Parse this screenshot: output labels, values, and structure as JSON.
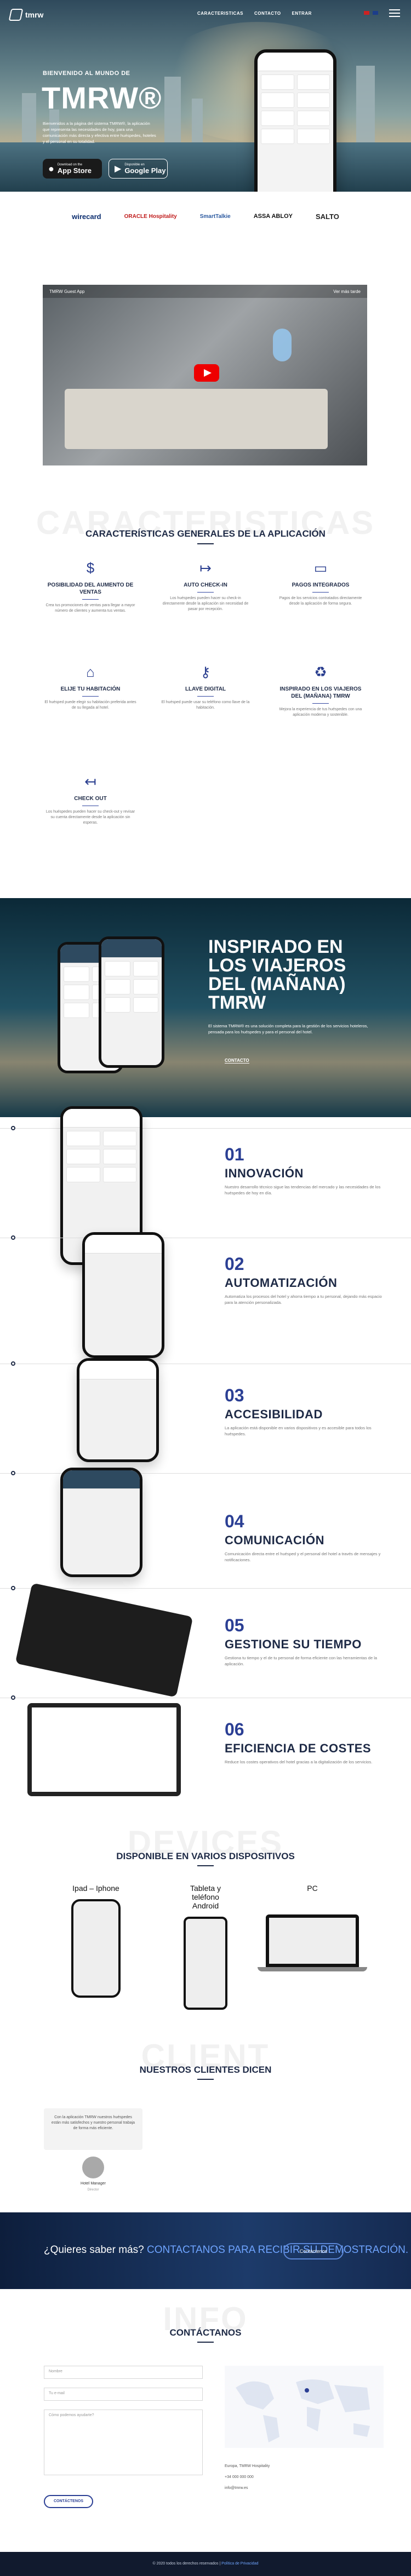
{
  "nav": {
    "brand": "tmrw",
    "links": [
      "CARACTERISTICAS",
      "CONTACTO",
      "ENTRAR"
    ]
  },
  "hero": {
    "subtitle": "BIENVENIDO AL MUNDO DE",
    "title": "TMRW®",
    "text": "Bienvenidos a la página del sistema TMRW®, la aplicación que representa las necesidades de hoy, para una comunicación más directa y efectiva entre huéspedes, hoteles y el personal en su totalidad.",
    "apple_small": "Download on the",
    "apple_big": "App Store",
    "google_small": "Disponible en",
    "google_big": "Google Play"
  },
  "partners": [
    "wirecard",
    "ORACLE Hospitality",
    "SmartTalkie",
    "ASSA ABLOY",
    "SALTO"
  ],
  "video": {
    "title": "TMRW Guest App",
    "action": "Ver más tarde"
  },
  "features": {
    "ghost": "CARACTERISTICAS",
    "title": "CARACTERÍSTICAS GENERALES DE LA APLICACIÓN",
    "items": [
      {
        "icon": "$",
        "title": "POSIBILIDAD DEL AUMENTO DE VENTAS",
        "text": "Crea tus promociones de ventas para llegar a mayor número de clientes y aumenta tus ventas."
      },
      {
        "icon": "↦",
        "title": "AUTO CHECK-IN",
        "text": "Los huéspedes pueden hacer su check-in directamente desde la aplicación sin necesidad de pasar por recepción."
      },
      {
        "icon": "▭",
        "title": "PAGOS INTEGRADOS",
        "text": "Pagos de los servicios contratados directamente desde la aplicación de forma segura."
      },
      {
        "icon": "⌂",
        "title": "ELIJE TU HABITACIÓN",
        "text": "El huésped puede elegir su habitación preferida antes de su llegada al hotel."
      },
      {
        "icon": "⚷",
        "title": "LLAVE DIGITAL",
        "text": "El huésped puede usar su teléfono como llave de la habitación."
      },
      {
        "icon": "♻",
        "title": "INSPIRADO EN LOS VIAJEROS DEL (MAÑANA) TMRW",
        "text": "Mejora la experiencia de tus huéspedes con una aplicación moderna y sostenible."
      },
      {
        "icon": "↤",
        "title": "CHECK OUT",
        "text": "Los huéspedes pueden hacer su check-out y revisar su cuenta directamente desde la aplicación sin esperas."
      }
    ]
  },
  "inspirado": {
    "title": "INSPIRADO EN LOS VIAJEROS DEL (MAÑANA) TMRW",
    "text": "El sistema TMRW® es una solución completa para la gestión de los servicios hoteleros, pensada para los huéspedes y para el personal del hotel.",
    "link": "CONTACTO"
  },
  "timeline": [
    {
      "num": "01",
      "title": "INNOVACIÓN",
      "text": "Nuestro desarrollo técnico sigue las tendencias del mercado y las necesidades de los huéspedes de hoy en día."
    },
    {
      "num": "02",
      "title": "AUTOMATIZACIÓN",
      "text": "Automatiza los procesos del hotel y ahorra tiempo a tu personal, dejando más espacio para la atención personalizada."
    },
    {
      "num": "03",
      "title": "ACCESIBILIDAD",
      "text": "La aplicación está disponible en varios dispositivos y es accesible para todos los huéspedes."
    },
    {
      "num": "04",
      "title": "COMUNICACIÓN",
      "text": "Comunicación directa entre el huésped y el personal del hotel a través de mensajes y notificaciones."
    },
    {
      "num": "05",
      "title": "GESTIONE SU TIEMPO",
      "text": "Gestiona tu tiempo y el de tu personal de forma eficiente con las herramientas de la aplicación."
    },
    {
      "num": "06",
      "title": "EFICIENCIA DE COSTES",
      "text": "Reduce los costes operativos del hotel gracias a la digitalización de los servicios."
    }
  ],
  "devices": {
    "ghost": "DEVICES",
    "title": "DISPONIBLE EN VARIOS DISPOSITIVOS",
    "items": [
      "Ipad – Iphone",
      "Tableta y teléfono Android",
      "PC"
    ]
  },
  "clients": {
    "ghost": "CLIENT",
    "title": "NUESTROS CLIENTES DICEN",
    "quote": "Con la aplicación TMRW nuestros huéspedes están más satisfechos y nuestro personal trabaja de forma más eficiente.",
    "name": "Hotel Manager",
    "role": "Director"
  },
  "cta": {
    "question": "¿Quieres saber más?",
    "highlight": "CONTACTANOS PARA RECIBIR SU DEMOSTRACIÓN.",
    "button": "Contáctenos"
  },
  "contact": {
    "ghost": "INFO",
    "title": "CONTÁCTANOS",
    "name_ph": "Nombre",
    "email_ph": "Tu e-mail",
    "message_ph": "Cómo podemos ayudarte?",
    "send": "CONTÁCTENOS",
    "address": "Europa, TMRW Hospitality",
    "phone": "+34 000 000 000",
    "email": "info@tmrw.es"
  },
  "footer": {
    "text": "© 2020 todos los derechos reservados",
    "link": "Política de Privacidad"
  }
}
